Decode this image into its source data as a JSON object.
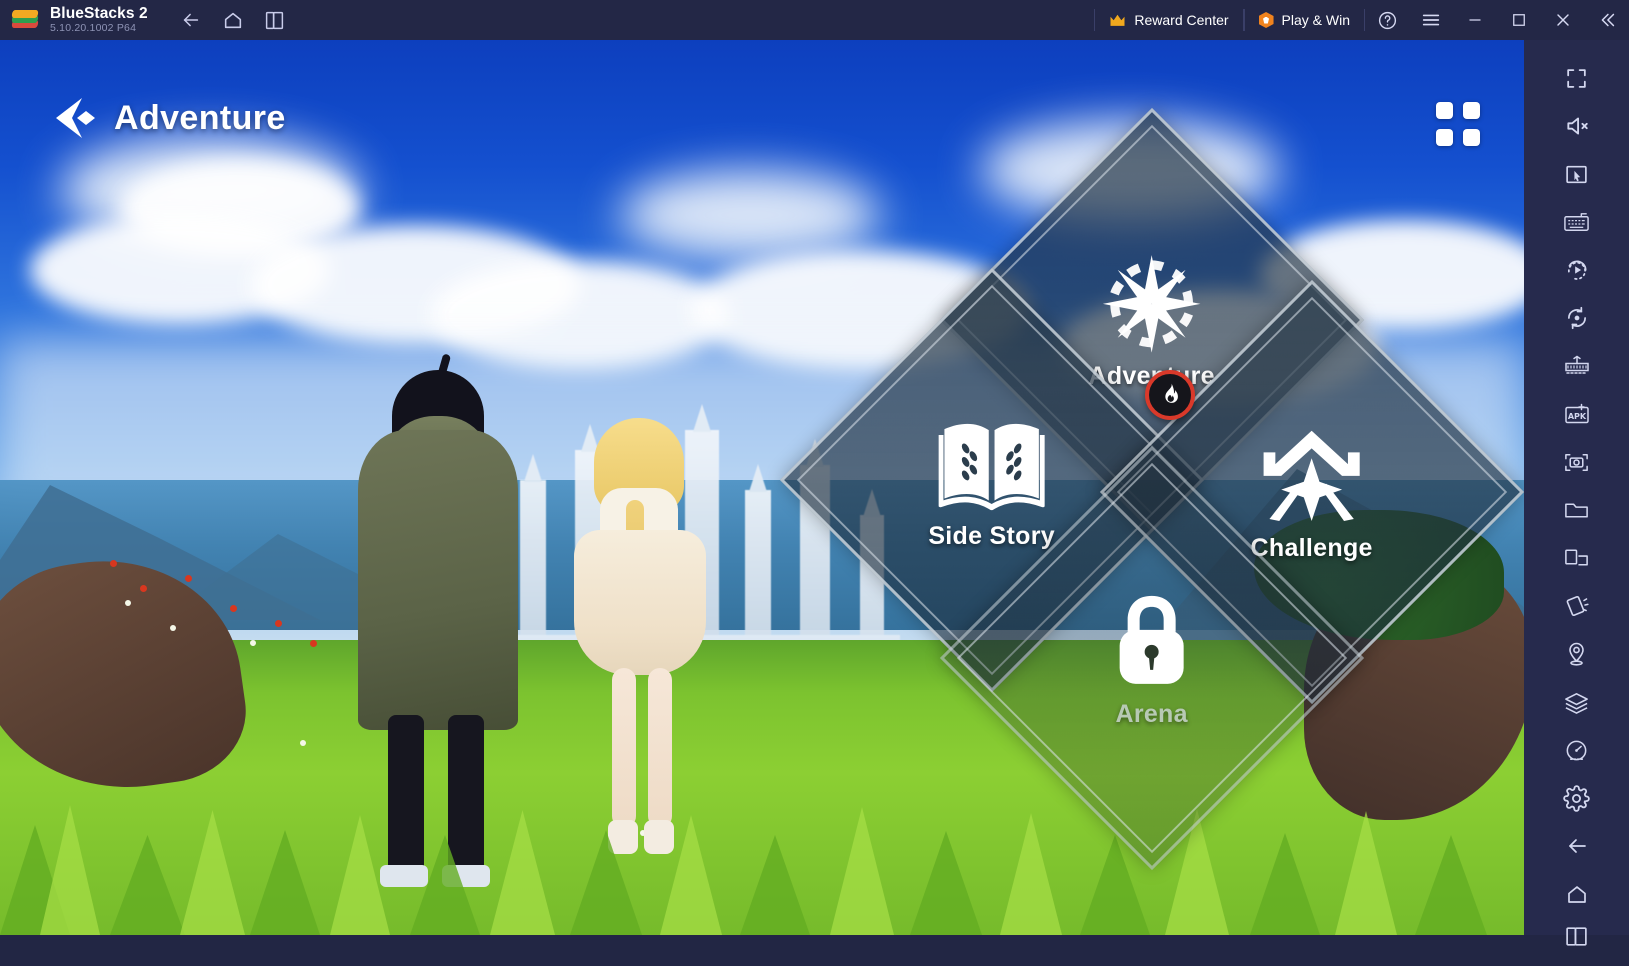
{
  "titlebar": {
    "app_name": "BlueStacks 2",
    "version": "5.10.20.1002  P64",
    "logo_icon": "bluestacks-logo-icon",
    "nav": [
      {
        "name": "back",
        "icon": "arrow-left-icon"
      },
      {
        "name": "home",
        "icon": "home-icon"
      },
      {
        "name": "multi-instance",
        "icon": "instance-manager-icon"
      }
    ],
    "reward_center": {
      "label": "Reward Center",
      "icon": "crown-icon"
    },
    "play_and_win": {
      "label": "Play & Win",
      "icon": "hexagon-coin-icon"
    },
    "help": {
      "icon": "help-circle-icon"
    },
    "menu": {
      "icon": "hamburger-menu-icon"
    },
    "minimize": {
      "icon": "minimize-icon"
    },
    "maximize": {
      "icon": "maximize-icon"
    },
    "close": {
      "icon": "close-icon"
    },
    "collapse": {
      "icon": "double-chevron-left-icon"
    },
    "bar_color": "#232746"
  },
  "game": {
    "header": {
      "back_icon": "game-back-arrow-icon",
      "title": "Adventure",
      "apps_grid_icon": "grid-dots-icon"
    },
    "menu_tiles": [
      {
        "id": "adventure",
        "label": "Adventure",
        "icon": "compass-rose-icon",
        "locked": false,
        "badge": null
      },
      {
        "id": "side-story",
        "label": "Side Story",
        "icon": "open-book-icon",
        "locked": false,
        "badge": null
      },
      {
        "id": "challenge",
        "label": "Challenge",
        "icon": "mountain-star-icon",
        "locked": false,
        "badge": "fire-badge-icon"
      },
      {
        "id": "arena",
        "label": "Arena",
        "icon": "padlock-icon",
        "locked": true,
        "badge": null
      }
    ],
    "scene": {
      "description": "anime field scene with two characters facing a distant castle",
      "sky_color": "#1450cf",
      "grass_color": "#8ccf33"
    }
  },
  "sidebar": {
    "background": "#262a4d",
    "items": [
      {
        "name": "fullscreen",
        "icon": "fullscreen-icon"
      },
      {
        "name": "mute",
        "icon": "volume-mute-icon"
      },
      {
        "name": "cursor-controls",
        "icon": "pointer-in-frame-icon"
      },
      {
        "name": "game-controls",
        "icon": "keyboard-icon"
      },
      {
        "name": "macro-recorder",
        "icon": "play-record-icon"
      },
      {
        "name": "sync-operations",
        "icon": "sync-circle-icon"
      },
      {
        "name": "multi-instance-sync",
        "icon": "instance-sync-icon"
      },
      {
        "name": "install-apk",
        "icon": "apk-install-icon"
      },
      {
        "name": "screenshot",
        "icon": "camera-icon"
      },
      {
        "name": "media-manager",
        "icon": "folder-icon"
      },
      {
        "name": "multi-window",
        "icon": "screen-split-icon"
      },
      {
        "name": "shake",
        "icon": "shake-device-icon"
      },
      {
        "name": "location",
        "icon": "location-pin-icon"
      },
      {
        "name": "layers",
        "icon": "layers-icon"
      },
      {
        "name": "performance",
        "icon": "speedometer-icon"
      }
    ],
    "bottom_items": [
      {
        "name": "settings",
        "icon": "gear-icon"
      },
      {
        "name": "android-back",
        "icon": "arrow-left-icon"
      },
      {
        "name": "android-home",
        "icon": "home-icon"
      },
      {
        "name": "recent-apps",
        "icon": "recent-apps-icon"
      }
    ]
  }
}
